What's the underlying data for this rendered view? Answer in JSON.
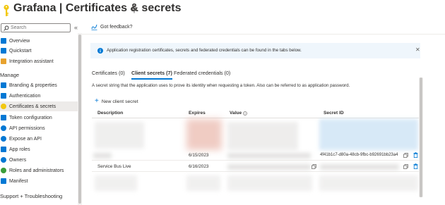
{
  "header": {
    "title": "Grafana | Certificates & secrets",
    "pin_label": "Pin",
    "more_label": "···"
  },
  "sidebar": {
    "search_placeholder": "Search",
    "collapse_label": "«",
    "items_top": [
      {
        "label": "Overview",
        "icon": "grid-icon",
        "color": "#0078d4"
      },
      {
        "label": "Quickstart",
        "icon": "rocket-icon",
        "color": "#0078d4"
      },
      {
        "label": "Integration assistant",
        "icon": "rocket-icon",
        "color": "#e8a22e"
      }
    ],
    "manage_heading": "Manage",
    "items_manage": [
      {
        "label": "Branding & properties",
        "icon": "branding-icon",
        "color": "#0078d4"
      },
      {
        "label": "Authentication",
        "icon": "authentication-icon",
        "color": "#0078d4"
      },
      {
        "label": "Certificates & secrets",
        "icon": "key-icon",
        "color": "#f2c811",
        "active": true
      },
      {
        "label": "Token configuration",
        "icon": "token-icon",
        "color": "#0078d4"
      },
      {
        "label": "API permissions",
        "icon": "api-permissions-icon",
        "color": "#0078d4"
      },
      {
        "label": "Expose an API",
        "icon": "cloud-icon",
        "color": "#0078d4"
      },
      {
        "label": "App roles",
        "icon": "app-roles-icon",
        "color": "#0078d4"
      },
      {
        "label": "Owners",
        "icon": "owners-icon",
        "color": "#0078d4"
      },
      {
        "label": "Roles and administrators",
        "icon": "roles-icon",
        "color": "#3a9d3a"
      },
      {
        "label": "Manifest",
        "icon": "manifest-icon",
        "color": "#0078d4"
      }
    ],
    "support_heading": "Support + Troubleshooting"
  },
  "command_bar": {
    "feedback_label": "Got feedback?"
  },
  "info_bar": {
    "text": "Application registration certificates, secrets and federated credentials can be found in the tabs below.",
    "close_label": "✕"
  },
  "tabs": [
    {
      "label": "Certificates (0)",
      "active": false
    },
    {
      "label": "Client secrets (7)",
      "active": true
    },
    {
      "label": "Federated credentials (0)",
      "active": false
    }
  ],
  "description": "A secret string that the application uses to prove its identity when requesting a token. Also can be referred to as application password.",
  "add_secret_label": "New client secret",
  "table": {
    "columns": {
      "description": "Description",
      "expires": "Expires",
      "value": "Value",
      "secret_id": "Secret ID"
    },
    "rows": [
      {
        "description": "",
        "expires": "6/15/2023",
        "value": "",
        "secret_id": "4f41b1c7-d80a-48cb-9fbc-b92691bb23a4"
      },
      {
        "description": "Service Bus Live",
        "expires": "6/16/2023",
        "value": "",
        "secret_id": ""
      }
    ]
  },
  "colors": {
    "accent": "#0078d4",
    "info_background": "#eff6fc",
    "active_nav": "#edebe9"
  }
}
